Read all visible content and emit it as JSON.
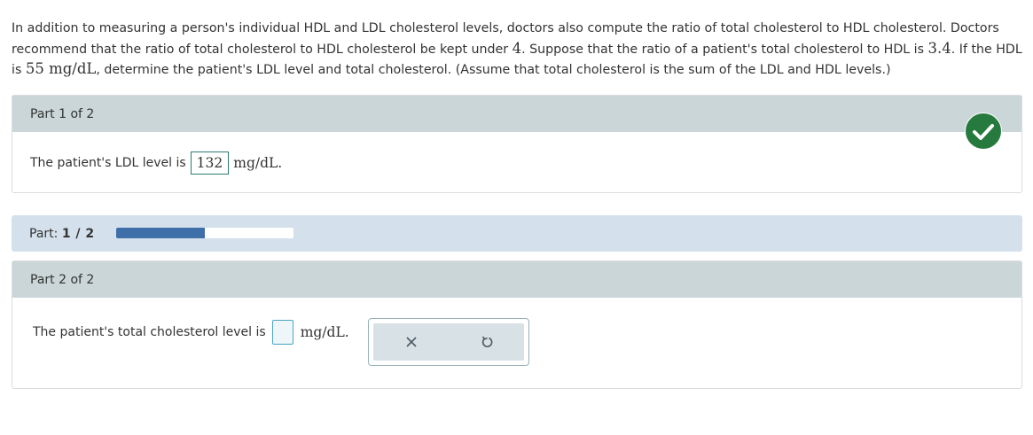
{
  "problem": {
    "text_1": "In addition to measuring a person's individual HDL and LDL cholesterol levels, doctors also compute the ratio of total cholesterol to HDL cholesterol. Doctors recommend that the ratio of total cholesterol to HDL cholesterol be kept under ",
    "max_ratio": "4",
    "text_2": ". Suppose that the ratio of a patient's total cholesterol to HDL is ",
    "ratio": "3.4",
    "text_3": ". If the HDL is ",
    "hdl": "55 mg/dL",
    "text_4": ", determine the patient's LDL level and total cholesterol. (Assume that total cholesterol is the sum of the LDL and HDL levels.)"
  },
  "part1": {
    "header": "Part 1 of 2",
    "prompt": "The patient's LDL level is",
    "answer": "132",
    "unit": "mg/dL.",
    "status_icon": "checkmark-icon",
    "status_color": "#277a3e"
  },
  "progress": {
    "label": "Part:",
    "value": "1 / 2",
    "fraction": 0.5,
    "fill_color": "#3e6fa8"
  },
  "part2": {
    "header": "Part 2 of 2",
    "prompt": "The patient's total cholesterol level is",
    "answer": "",
    "unit": "mg/dL."
  },
  "tools": {
    "clear_icon": "close-icon",
    "undo_icon": "undo-icon"
  }
}
